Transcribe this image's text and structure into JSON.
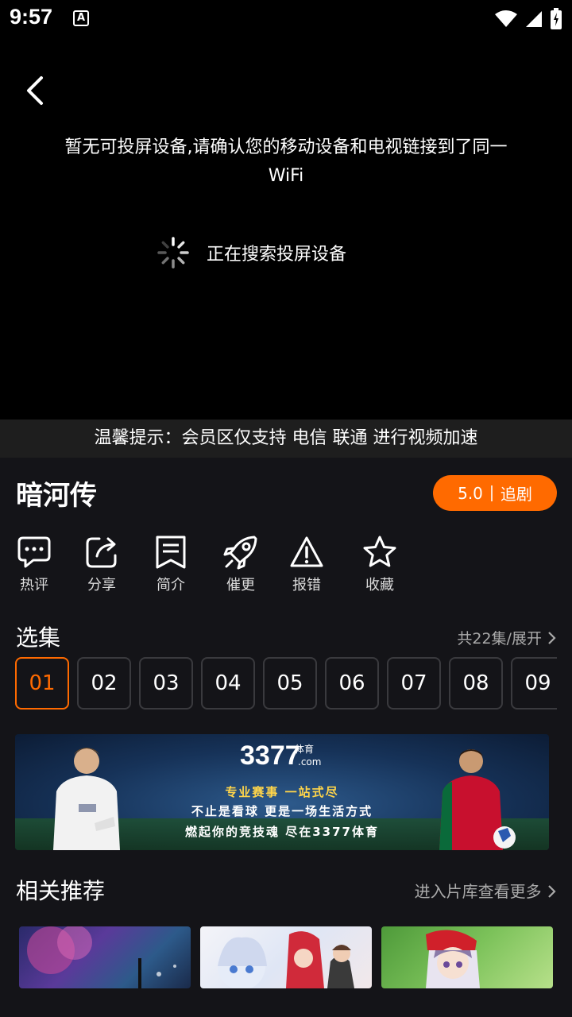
{
  "status_bar": {
    "time": "9:57",
    "notification_icon": "A"
  },
  "player": {
    "cast_message": "暂无可投屏设备,请确认您的移动设备和电视链接到了同一WiFi",
    "searching_text": "正在搜索投屏设备"
  },
  "notice": "温馨提示：会员区仅支持 电信 联通 进行视频加速",
  "show": {
    "title": "暗河传",
    "rating": "5.0",
    "follow_label": "追剧"
  },
  "actions": [
    {
      "label": "热评",
      "icon": "comment-icon"
    },
    {
      "label": "分享",
      "icon": "share-icon"
    },
    {
      "label": "简介",
      "icon": "bookmark-icon"
    },
    {
      "label": "催更",
      "icon": "rocket-icon"
    },
    {
      "label": "报错",
      "icon": "warning-icon"
    },
    {
      "label": "收藏",
      "icon": "star-icon"
    }
  ],
  "episodes": {
    "title": "选集",
    "more": "共22集/展开",
    "items": [
      "01",
      "02",
      "03",
      "04",
      "05",
      "06",
      "07",
      "08",
      "09"
    ],
    "selected": "01"
  },
  "banner": {
    "logo": "3377",
    "logo_sub": "体育",
    "logo_com": ".com",
    "line1": "专业赛事  一站式尽",
    "line2": "不止是看球  更是一场生活方式",
    "line3": "燃起你的竞技魂  尽在3377体育"
  },
  "recommend": {
    "title": "相关推荐",
    "more": "进入片库查看更多"
  },
  "colors": {
    "accent": "#ff6a00",
    "background": "#141418",
    "notice_bg": "#1e1e1e"
  }
}
